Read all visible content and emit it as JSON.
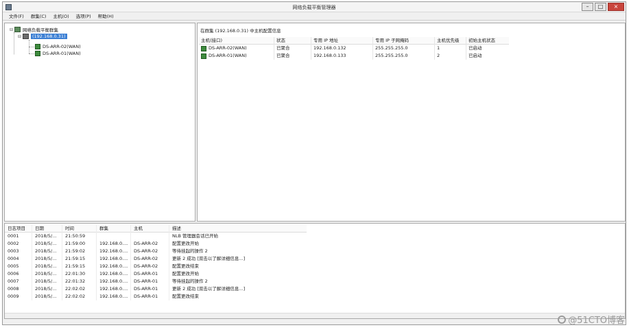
{
  "window": {
    "title": "网络负载平衡管理器",
    "controls": {
      "minimize": "–",
      "maximize": "□",
      "close": "×"
    }
  },
  "menu": [
    "文件(F)",
    "群集(C)",
    "主机(O)",
    "选项(P)",
    "帮助(H)"
  ],
  "tree": {
    "root_label": "网络负载平衡群集",
    "cluster_label": "(192.168.0.31)",
    "hosts": [
      "DS-ARR-02(WAN)",
      "DS-ARR-01(WAN)"
    ]
  },
  "detail": {
    "header": "在群集 (192.168.0.31) 中主机配置信息",
    "columns": [
      "主机(接口)",
      "状态",
      "专用 IP 地址",
      "专用 IP 子网掩码",
      "主机优先级",
      "初始主机状态"
    ],
    "rows": [
      [
        "DS-ARR-02(WAN)",
        "已聚合",
        "192.168.0.132",
        "255.255.255.0",
        "1",
        "已启动"
      ],
      [
        "DS-ARR-01(WAN)",
        "已聚合",
        "192.168.0.133",
        "255.255.255.0",
        "2",
        "已启动"
      ]
    ]
  },
  "log": {
    "columns": [
      "日志项目",
      "日期",
      "时间",
      "群集",
      "主机",
      "描述"
    ],
    "rows": [
      [
        "0001",
        "2018/5/...",
        "21:50:59",
        "",
        "",
        "NLB 管理器会话已开始"
      ],
      [
        "0002",
        "2018/5/...",
        "21:59:00",
        "192.168.0....",
        "DS-ARR-02",
        "配置更改开始"
      ],
      [
        "0003",
        "2018/5/...",
        "21:59:02",
        "192.168.0....",
        "DS-ARR-02",
        "等待挂起的操作 2"
      ],
      [
        "0004",
        "2018/5/...",
        "21:59:15",
        "192.168.0....",
        "DS-ARR-02",
        "更新 2 成功 [双击以了解详细信息...]"
      ],
      [
        "0005",
        "2018/5/...",
        "21:59:15",
        "192.168.0....",
        "DS-ARR-02",
        "配置更改结束"
      ],
      [
        "0006",
        "2018/5/...",
        "22:01:30",
        "192.168.0....",
        "DS-ARR-01",
        "配置更改开始"
      ],
      [
        "0007",
        "2018/5/...",
        "22:01:32",
        "192.168.0....",
        "DS-ARR-01",
        "等待挂起的操作 2"
      ],
      [
        "0008",
        "2018/5/...",
        "22:02:02",
        "192.168.0....",
        "DS-ARR-01",
        "更新 2 成功 [双击以了解详细信息...]"
      ],
      [
        "0009",
        "2018/5/...",
        "22:02:02",
        "192.168.0....",
        "DS-ARR-01",
        "配置更改结束"
      ]
    ]
  },
  "watermark": "@51CTO博客",
  "icons": {
    "app": "nlb-manager-icon",
    "root": "cluster-root-icon",
    "cluster": "cluster-icon",
    "host": "host-icon"
  }
}
